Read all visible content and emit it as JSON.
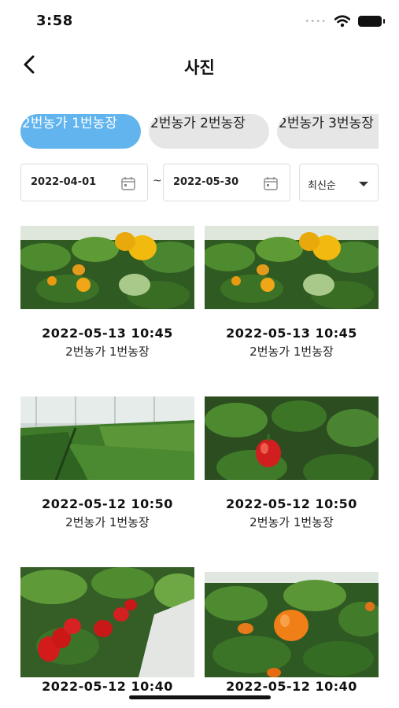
{
  "status_bar": {
    "time": "3:58"
  },
  "header": {
    "title": "사진"
  },
  "farm_tabs": [
    {
      "label": "2번농가 1번농장",
      "active": true
    },
    {
      "label": "2번농가 2번농장",
      "active": false
    },
    {
      "label": "2번농가 3번농장",
      "active": false
    }
  ],
  "filters": {
    "start_date": "2022-04-01",
    "separator": "~",
    "end_date": "2022-05-30",
    "sort": "최신순"
  },
  "colors": {
    "accent": "#62b4ee",
    "chip_inactive": "#e6e6e6"
  },
  "photos": [
    {
      "datetime": "2022-05-13 10:45",
      "farm": "2번농가 1번농장",
      "subject": "yellow-pepper"
    },
    {
      "datetime": "2022-05-13 10:45",
      "farm": "2번농가 1번농장",
      "subject": "yellow-pepper"
    },
    {
      "datetime": "2022-05-12 10:50",
      "farm": "2번농가 1번농장",
      "subject": "greenhouse-rows"
    },
    {
      "datetime": "2022-05-12 10:50",
      "farm": "2번농가 1번농장",
      "subject": "red-pepper"
    },
    {
      "datetime": "2022-05-12 10:40",
      "farm": "",
      "subject": "red-peppers"
    },
    {
      "datetime": "2022-05-12 10:40",
      "farm": "",
      "subject": "orange-pepper"
    }
  ]
}
